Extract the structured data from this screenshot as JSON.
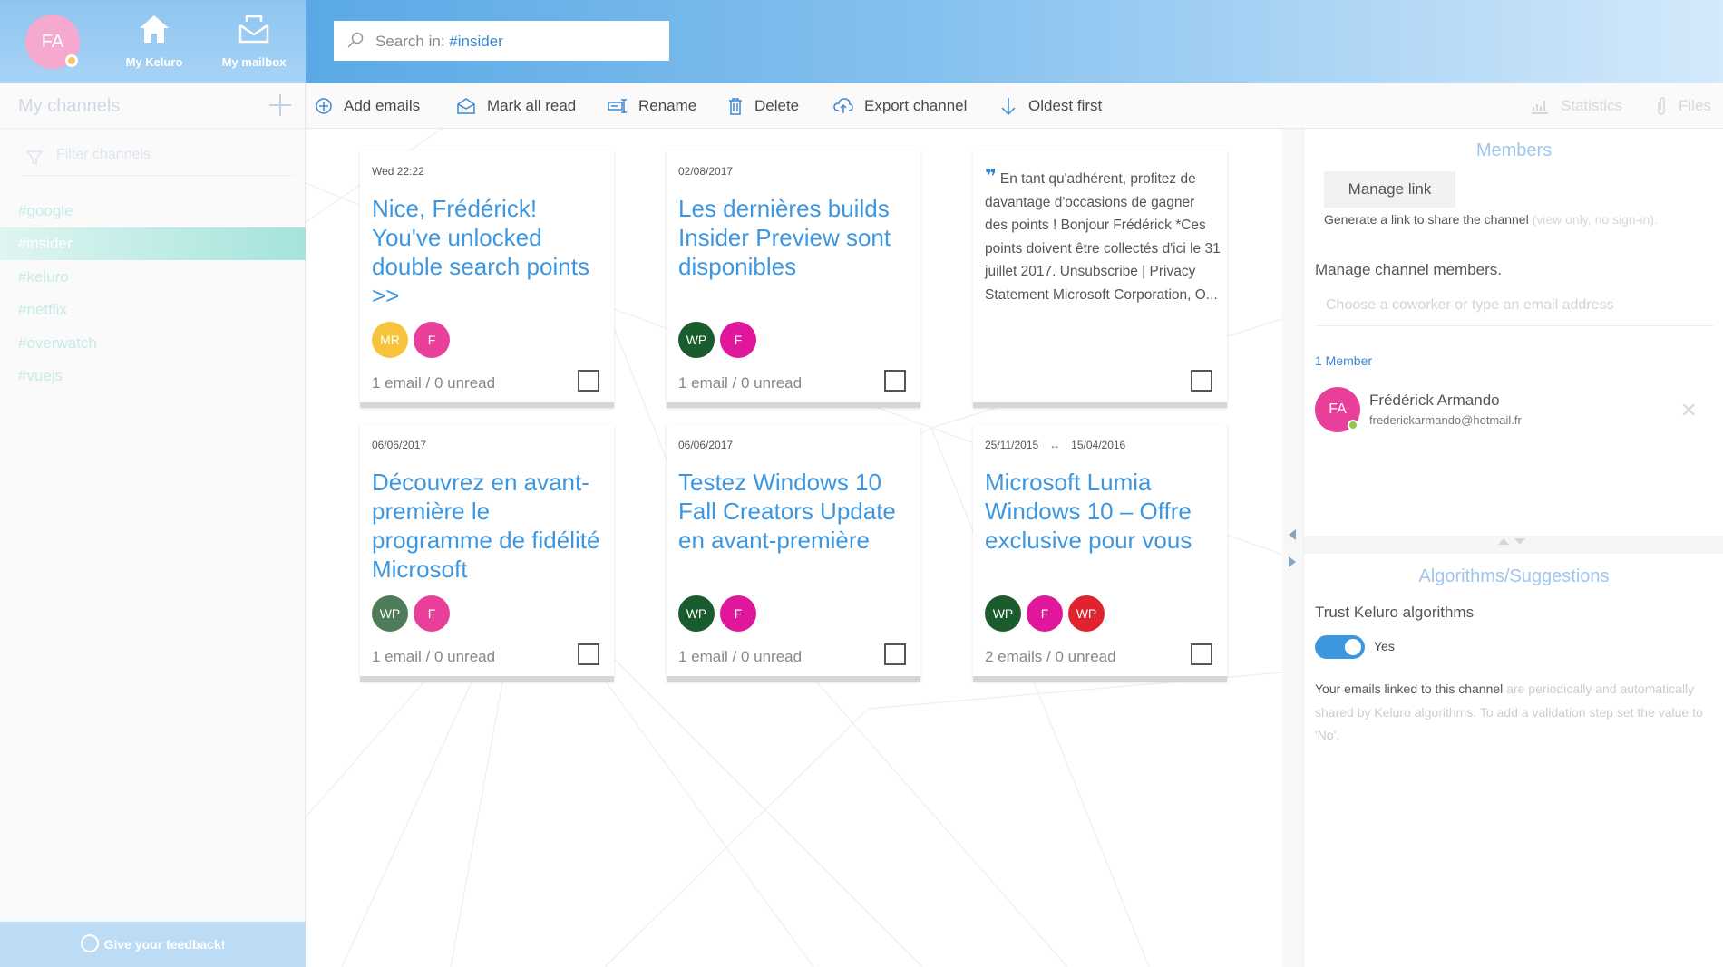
{
  "sidebar": {
    "user_initials": "FA",
    "nav": [
      {
        "label": "My Keluro",
        "icon": "home-icon"
      },
      {
        "label": "My mailbox",
        "icon": "mailbox-icon"
      }
    ],
    "channels_title": "My channels",
    "filter_placeholder": "Filter channels",
    "channels": [
      "#google",
      "#insider",
      "#keluro",
      "#netflix",
      "#overwatch",
      "#vuejs"
    ],
    "active_channel": "#insider",
    "feedback_label": "Give your feedback!"
  },
  "search": {
    "prefix": "Search in:",
    "channel": "#insider"
  },
  "toolbar": {
    "items": [
      {
        "label": "Add emails",
        "icon": "add-circle-icon"
      },
      {
        "label": "Mark all read",
        "icon": "envelope-open-icon"
      },
      {
        "label": "Rename",
        "icon": "rename-icon"
      },
      {
        "label": "Delete",
        "icon": "trash-icon"
      },
      {
        "label": "Export channel",
        "icon": "cloud-upload-icon"
      },
      {
        "label": "Oldest first",
        "icon": "arrow-down-icon"
      }
    ],
    "statistics_label": "Statistics",
    "files_label": "Files"
  },
  "cards": [
    {
      "date": "Wed 22:22",
      "title": "Nice, Frédérick! You've unlocked double search points >>",
      "avatars": [
        {
          "initials": "MR",
          "color": "#f7c33a"
        },
        {
          "initials": "F",
          "color": "#e8409a"
        }
      ],
      "count": "1 email / 0 unread"
    },
    {
      "date": "02/08/2017",
      "title": "Les dernières builds Insider Preview sont disponibles",
      "avatars": [
        {
          "initials": "WP",
          "color": "#1a5c2e"
        },
        {
          "initials": "F",
          "color": "#e0179a"
        }
      ],
      "count": "1 email / 0 unread"
    },
    {
      "quote": "En tant qu'adhérent, profitez de davantage d'occasions de gagner des points ! Bonjour Frédérick *Ces points doivent être collectés d'ici le 31 juillet 2017. Unsubscribe | Privacy Statement Microsoft Corporation, O..."
    },
    {
      "date": "06/06/2017",
      "title": "Découvrez en avant-première le programme de fidélité Microsoft",
      "avatars": [
        {
          "initials": "WP",
          "color": "#4f7c58"
        },
        {
          "initials": "F",
          "color": "#e8409a"
        }
      ],
      "count": "1 email / 0 unread"
    },
    {
      "date": "06/06/2017",
      "title": "Testez Windows 10 Fall Creators Update en avant-première",
      "avatars": [
        {
          "initials": "WP",
          "color": "#1a5c2e"
        },
        {
          "initials": "F",
          "color": "#e0179a"
        }
      ],
      "count": "1 email / 0 unread"
    },
    {
      "date_from": "25/11/2015",
      "date_to": "15/04/2016",
      "title": "Microsoft Lumia Windows 10 – Offre exclusive pour vous",
      "avatars": [
        {
          "initials": "WP",
          "color": "#1a5c2e"
        },
        {
          "initials": "F",
          "color": "#e0179a"
        },
        {
          "initials": "WP",
          "color": "#e0242f"
        }
      ],
      "count": "2 emails / 0 unread"
    }
  ],
  "members": {
    "title": "Members",
    "manage_link_label": "Manage link",
    "generate_text": "Generate a link to share the channel",
    "generate_note": "(view only, no sign-in).",
    "manage_members_label": "Manage channel members.",
    "coworker_placeholder": "Choose a coworker or type an email address",
    "member_count": "1 Member",
    "list": [
      {
        "initials": "FA",
        "name": "Frédérick Armando",
        "email": "frederickarmando@hotmail.fr"
      }
    ]
  },
  "algorithms": {
    "title": "Algorithms/Suggestions",
    "trust_label": "Trust Keluro algorithms",
    "toggle_value": "Yes",
    "description_1": "Your emails linked to this channel",
    "description_2": "are periodically and automatically shared by Keluro algorithms.",
    "description_3": "To add a validation step set the value to 'No'."
  },
  "colors": {
    "accent": "#3d97e0",
    "active_channel": "#a4e3db"
  }
}
